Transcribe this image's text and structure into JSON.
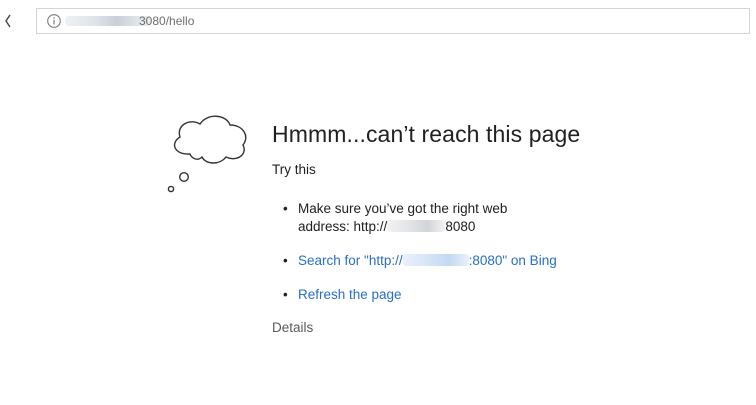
{
  "browser": {
    "address_bar": {
      "url_visible": "3080/hello",
      "info_icon": "info-icon",
      "back_icon": "back-arrow-icon"
    }
  },
  "error_page": {
    "title": "Hmmm...can’t reach this page",
    "try_this": "Try this",
    "suggestions": [
      {
        "line1": "Make sure you’ve got the right web",
        "line2_prefix": "address: http://",
        "line2_suffix": "8080"
      },
      {
        "prefix": "Search for \"http://",
        "suffix": ":8080\" on Bing"
      },
      {
        "label": "Refresh the page"
      }
    ],
    "details": "Details",
    "cloud_icon": "thought-cloud-icon"
  },
  "colors": {
    "link": "#2a6ec6",
    "text": "#202020",
    "muted": "#5a5a5a"
  }
}
